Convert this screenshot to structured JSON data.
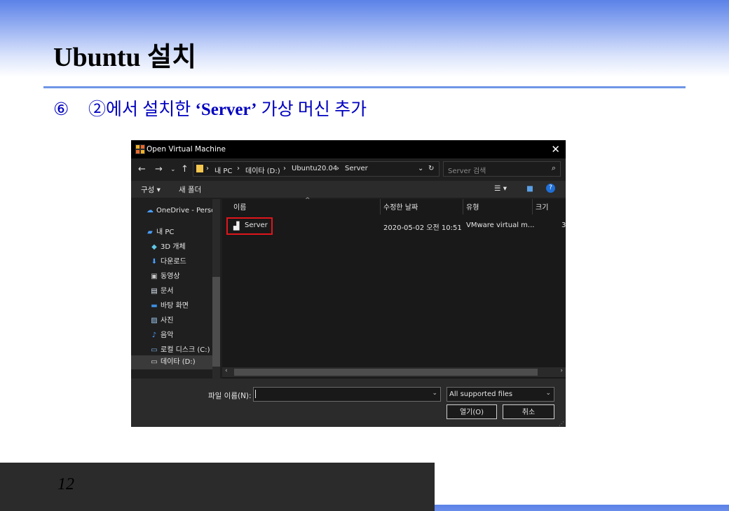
{
  "slide": {
    "title": "Ubuntu 설치",
    "step_number": "⑥",
    "step_prefix": "②에서 설치한 ",
    "step_bold": "‘Server’",
    "step_suffix": " 가상 머신 추가",
    "page_number": "12"
  },
  "dialog": {
    "title": "Open Virtual Machine",
    "breadcrumb": [
      "내 PC",
      "데이타 (D:)",
      "Ubuntu20.04",
      "Server"
    ],
    "search_placeholder": "Server 검색",
    "toolbar": {
      "organize": "구성 ▾",
      "new_folder": "새 폴더"
    },
    "nav_items": [
      {
        "icon": "☁",
        "label": "OneDrive - Persor"
      },
      {
        "icon": "▰",
        "label": "내 PC"
      },
      {
        "icon": "◆",
        "label": "3D 개체"
      },
      {
        "icon": "⬇",
        "label": "다운로드"
      },
      {
        "icon": "▣",
        "label": "동영상"
      },
      {
        "icon": "▤",
        "label": "문서"
      },
      {
        "icon": "▬",
        "label": "바탕 화면"
      },
      {
        "icon": "▨",
        "label": "사진"
      },
      {
        "icon": "♪",
        "label": "음악"
      },
      {
        "icon": "▭",
        "label": "로컬 디스크 (C:)"
      },
      {
        "icon": "▭",
        "label": "데이타 (D:)"
      }
    ],
    "columns": [
      "이름",
      "수정한 날짜",
      "유형",
      "크기"
    ],
    "files": [
      {
        "name": "Server",
        "modified": "2020-05-02 오전 10:51",
        "type": "VMware virtual m...",
        "size": "3"
      }
    ],
    "file_name_label": "파일 이름(N):",
    "file_name_value": "",
    "filter": "All supported files",
    "open_button": "열기(O)",
    "cancel_button": "취소",
    "accent": "#e0151b"
  }
}
